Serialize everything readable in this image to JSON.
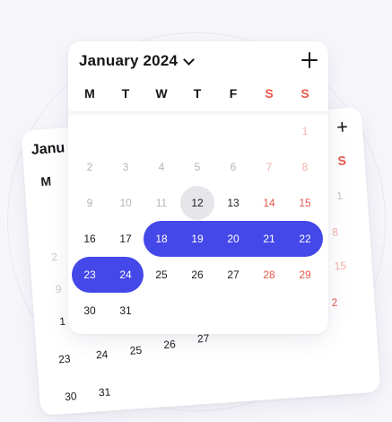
{
  "calendar": {
    "title": "January 2024",
    "weekdays": [
      {
        "label": "M",
        "weekend": false
      },
      {
        "label": "T",
        "weekend": false
      },
      {
        "label": "W",
        "weekend": false
      },
      {
        "label": "T",
        "weekend": false
      },
      {
        "label": "F",
        "weekend": false
      },
      {
        "label": "S",
        "weekend": true
      },
      {
        "label": "S",
        "weekend": true
      }
    ],
    "today": "12",
    "selected_range": {
      "start": "18",
      "end": "24"
    },
    "weeks": [
      [
        "",
        "",
        "",
        "",
        "",
        "",
        "1"
      ],
      [
        "2",
        "3",
        "4",
        "5",
        "6",
        "7",
        "8"
      ],
      [
        "9",
        "10",
        "11",
        "12",
        "13",
        "14",
        "15"
      ],
      [
        "16",
        "17",
        "18",
        "19",
        "20",
        "21",
        "22"
      ],
      [
        "23",
        "24",
        "25",
        "26",
        "27",
        "28",
        "29"
      ],
      [
        "30",
        "31",
        "",
        "",
        "",
        "",
        ""
      ]
    ],
    "faded_through_day": 11
  },
  "back_calendar": {
    "title": "Janu",
    "weekday_first": "M",
    "weekday_last": "S",
    "visible_days": [
      "1",
      "2",
      "9",
      "15",
      "8",
      "1",
      "2",
      "23",
      "24",
      "25",
      "26",
      "27",
      "29",
      "30",
      "31"
    ]
  },
  "colors": {
    "accent": "#4448e8",
    "weekend": "#e8574c",
    "today_bg": "#e6e6ea"
  },
  "icons": {
    "add": "plus-icon",
    "dropdown": "chevron-down-icon"
  }
}
